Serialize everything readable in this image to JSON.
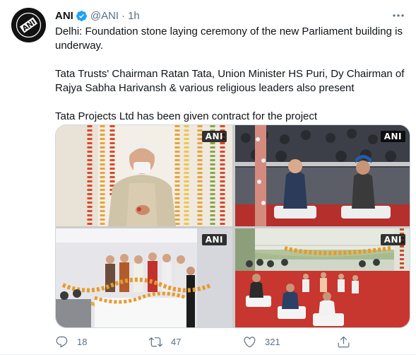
{
  "tweet": {
    "author_name": "ANI",
    "author_handle": "@ANI",
    "separator": "·",
    "time": "1h",
    "avatar_text": "ANI",
    "paragraphs": [
      "Delhi: Foundation stone laying ceremony of the new Parliament building is underway.",
      "Tata Trusts' Chairman Ratan Tata, Union Minister HS Puri, Dy Chairman of Rajya Sabha Harivansh & various religious leaders also present",
      "Tata Projects Ltd has been given contract for the project"
    ]
  },
  "media": {
    "watermark": "ANI",
    "photos": [
      {
        "description_name": "photo-pm-ceremony"
      },
      {
        "description_name": "photo-seated-guests"
      },
      {
        "description_name": "photo-stage-flowers"
      },
      {
        "description_name": "photo-tent-venue"
      }
    ]
  },
  "actions": {
    "reply_count": "18",
    "retweet_count": "47",
    "like_count": "321"
  },
  "icons": {
    "verified": "verified-badge-icon",
    "more": "more-options-icon",
    "reply": "reply-icon",
    "retweet": "retweet-icon",
    "like": "like-icon",
    "share": "share-icon"
  },
  "colors": {
    "verified_blue": "#1da1f2",
    "secondary_text": "#5b7083",
    "border": "#cfd9de"
  }
}
